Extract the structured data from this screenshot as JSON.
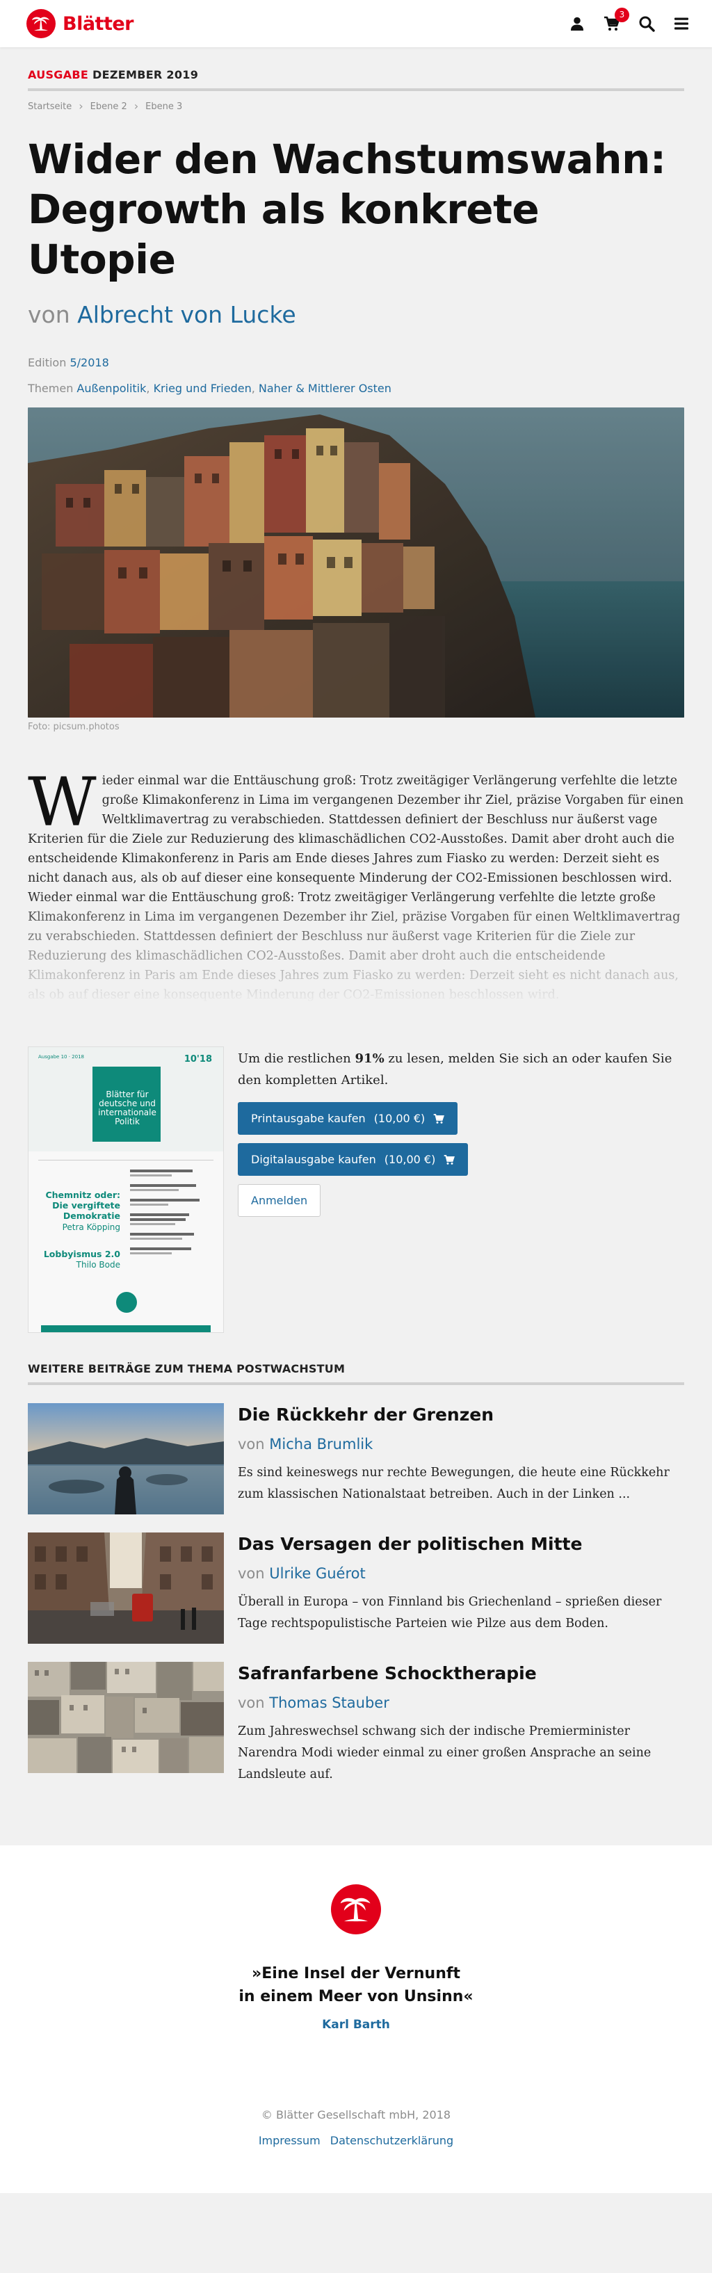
{
  "header": {
    "brand": "Blätter",
    "cart_count": "3",
    "icons": [
      "user-icon",
      "cart-icon",
      "search-icon",
      "menu-icon"
    ]
  },
  "issue": {
    "label_prefix": "AUSGABE",
    "label_rest": "DEZEMBER 2019"
  },
  "breadcrumb": [
    "Startseite",
    "Ebene 2",
    "Ebene 3"
  ],
  "article": {
    "title": "Wider den Wachstumswahn: Degrowth als konkrete Utopie",
    "byline_prefix": "von",
    "author": "Albrecht von Lucke",
    "edition_label": "Edition",
    "edition_value": "5/2018",
    "themes_label": "Themen",
    "themes": [
      "Außenpolitik",
      "Krieg und Frieden",
      "Naher & Mittlerer Osten"
    ],
    "photo_credit": "Foto: picsum.photos",
    "dropcap": "W",
    "body": "ieder einmal war die Enttäuschung groß: Trotz zweitägiger Verlängerung verfehlte die letzte große Klimakonferenz in Lima im vergangenen Dezember ihr Ziel, präzise Vorgaben für einen Weltklimavertrag zu verabschieden. Stattdessen definiert der Beschluss nur äußerst vage Kriterien für die Ziele zur Reduzierung des klimaschädlichen CO2-Ausstoßes. Damit aber droht auch die entscheidende Klimakonferenz in Paris am Ende dieses Jahres zum Fiasko zu werden: Derzeit sieht es nicht danach aus, als ob auf dieser eine konsequente Minderung der CO2-Emissionen beschlossen wird. Wieder einmal war die Enttäuschung groß: Trotz zweitägiger Verlängerung verfehlte die letzte große Klimakonferenz in Lima im vergangenen Dezember ihr Ziel, präzise Vorgaben für einen Weltklimavertrag zu verabschieden. Stattdessen definiert der Beschluss nur äußerst vage Kriterien für die Ziele zur Reduzierung des klimaschädlichen CO2-Ausstoßes. Damit aber droht auch die entscheidende Klimakonferenz in Paris am Ende dieses Jahres zum Fiasko zu werden: Derzeit sieht es nicht danach aus, als ob auf dieser eine konsequente Minderung der CO2-Emissionen beschlossen wird."
  },
  "paywall": {
    "text_before": "Um die restlichen",
    "percent": "91%",
    "text_after": "zu lesen, melden Sie sich an oder kaufen Sie den kompletten Artikel.",
    "print_button": "Printausgabe kaufen",
    "print_price": "(10,00 €)",
    "digital_button": "Digitalausgabe kaufen",
    "digital_price": "(10,00 €)",
    "login_button": "Anmelden",
    "cover": {
      "issue_small": "Ausgabe 10 · 2018",
      "issue_number": "10'18",
      "journal_title": "Blätter für deutsche und internationale Politik",
      "feature1_title": "Chemnitz oder: Die vergiftete Demokratie",
      "feature1_author": "Petra Köpping",
      "feature2_title": "Lobbyismus 2.0",
      "feature2_author": "Thilo Bode"
    }
  },
  "related": {
    "heading": "WEITERE BEITRÄGE ZUM THEMA POSTWACHSTUM",
    "byline_prefix": "von",
    "items": [
      {
        "title": "Die Rückkehr der Grenzen",
        "author": "Micha Brumlik",
        "teaser": "Es sind keineswegs nur rechte Bewegungen, die heute eine Rückkehr zum klassischen Nationalstaat betreiben. Auch in der Linken ..."
      },
      {
        "title": "Das Versagen der politischen Mitte",
        "author": "Ulrike Guérot",
        "teaser": "Überall in Europa – von Finnland bis Griechenland – sprießen dieser Tage rechtspopulistische Parteien wie Pilze aus dem Boden."
      },
      {
        "title": "Safranfarbene Schocktherapie",
        "author": "Thomas Stauber",
        "teaser": "Zum Jahreswechsel schwang sich der indische Premierminister Narendra Modi wieder einmal zu einer großen Ansprache an seine Landsleute auf."
      }
    ]
  },
  "footer": {
    "quote_line1": "»Eine Insel der Vernunft",
    "quote_line2": "in einem Meer von Unsinn«",
    "quote_author": "Karl Barth",
    "copyright": "© Blätter Gesellschaft mbH, 2018",
    "links": [
      "Impressum",
      "Datenschutzerklärung"
    ]
  },
  "colors": {
    "brand_red": "#e2001a",
    "link_blue": "#1e6a9e",
    "cover_teal": "#0e8a7a"
  }
}
